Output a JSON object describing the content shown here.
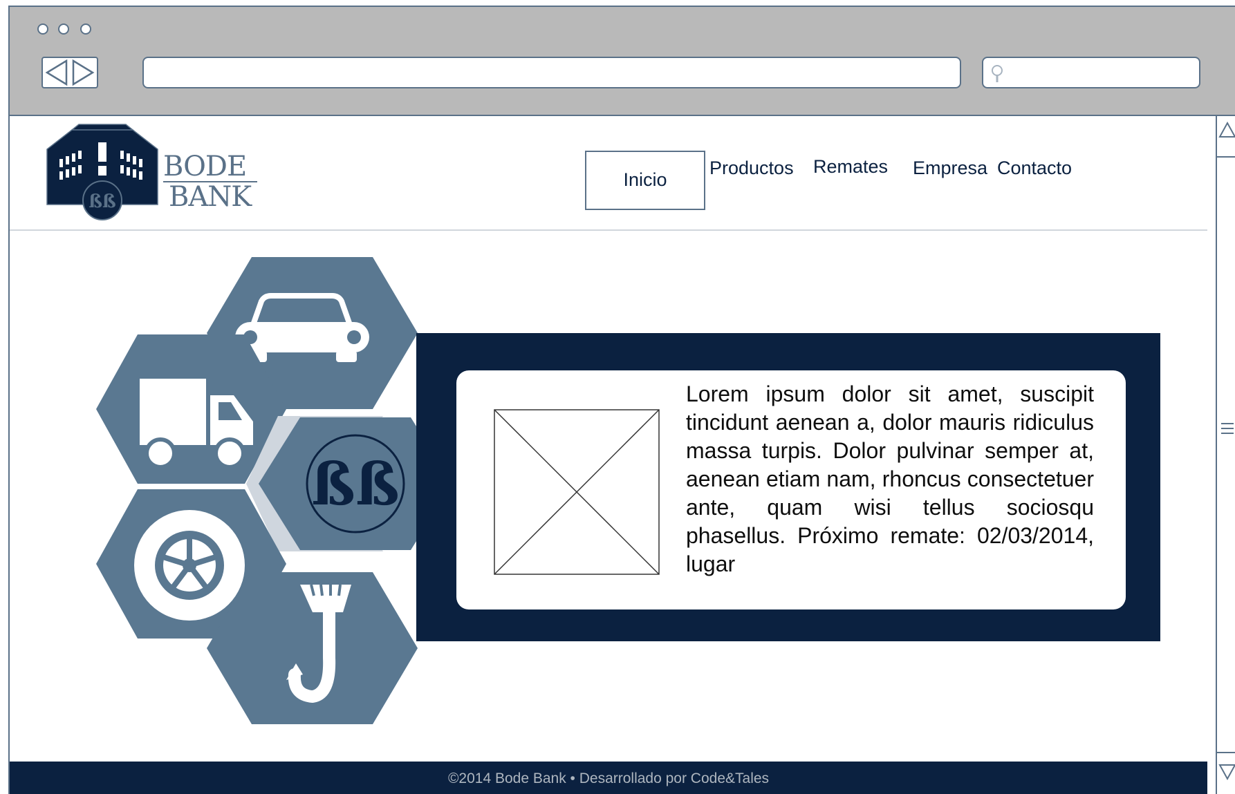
{
  "browser": {
    "url": "",
    "search_placeholder": ""
  },
  "brand": {
    "name_line1": "BODE",
    "name_line2": "BANK"
  },
  "nav": {
    "items": [
      {
        "label": "Inicio",
        "active": true
      },
      {
        "label": "Productos",
        "active": false
      },
      {
        "label": "Remates",
        "active": false
      },
      {
        "label": "Empresa",
        "active": false
      },
      {
        "label": "Contacto",
        "active": false
      }
    ]
  },
  "hero": {
    "icons": [
      "car-icon",
      "truck-icon",
      "bodebank-emblem-icon",
      "wheel-icon",
      "crane-hook-icon"
    ],
    "card_text": "Lorem ipsum dolor sit amet, suscipit tincidunt aenean a, dolor mauris ridiculus massa turpis. Dolor pulvinar semper at, aenean etiam nam, rhoncus consectetuer ante, quam wisi tellus sociosqu phasellus. Próximo remate: 02/03/2014, lugar",
    "colors": {
      "hex": "#5a7891",
      "banner": "#0b2140",
      "chevron": "#cfd6de"
    }
  },
  "footer": {
    "text": "©2014  Bode Bank • Desarrollado por  Code&Tales"
  }
}
